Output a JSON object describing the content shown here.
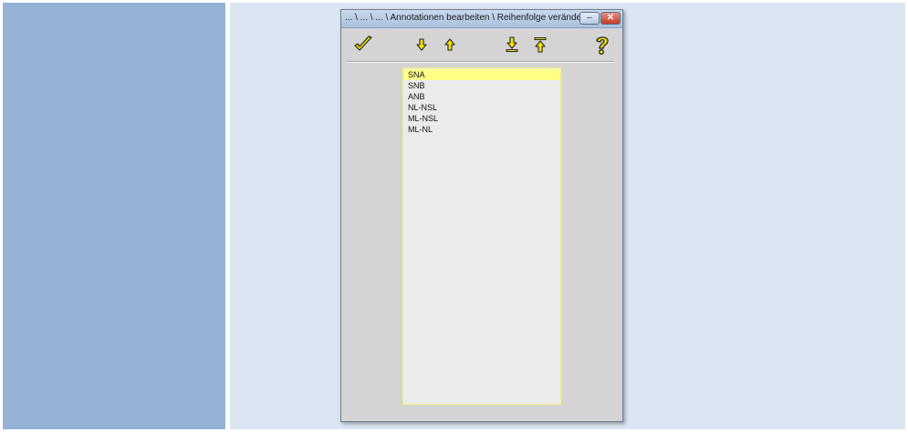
{
  "window": {
    "title": "... \\ ... \\ ... \\ Annotationen bearbeiten \\ Reihenfolge verändern",
    "minimize_icon": "minimize-icon",
    "close_icon": "close-icon"
  },
  "colors": {
    "left_pane": "#95b3d7",
    "right_pane": "#dce6f2",
    "selection": "#ffff88",
    "icon_yellow": "#f5e400"
  },
  "toolbar": [
    {
      "name": "confirm-button",
      "icon": "checkmark-icon"
    },
    {
      "name": "move-down-button",
      "icon": "arrow-down-icon"
    },
    {
      "name": "move-up-button",
      "icon": "arrow-up-icon"
    },
    {
      "name": "move-to-bottom-button",
      "icon": "arrow-to-bottom-icon"
    },
    {
      "name": "move-to-top-button",
      "icon": "arrow-to-top-icon"
    },
    {
      "name": "help-button",
      "icon": "help-icon"
    }
  ],
  "list": {
    "selected_index": 0,
    "items": [
      "SNA",
      "SNB",
      "ANB",
      "NL-NSL",
      "ML-NSL",
      "ML-NL"
    ]
  }
}
